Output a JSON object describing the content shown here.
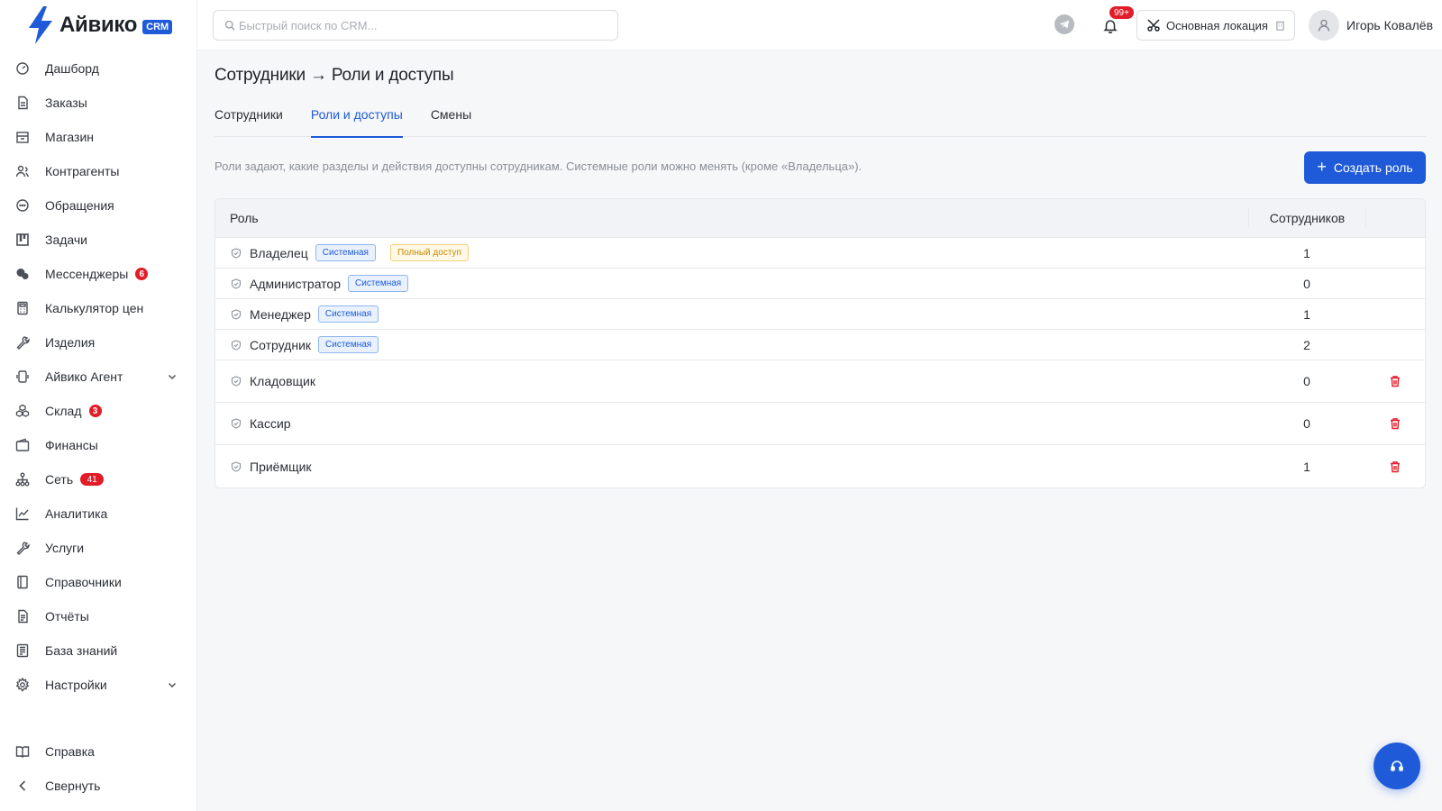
{
  "brand": {
    "name": "Айвико",
    "badge": "CRM",
    "accent": "#1f5bd8"
  },
  "sidebar": {
    "items": [
      {
        "label": "Дашборд",
        "icon": "dashboard-icon"
      },
      {
        "label": "Заказы",
        "icon": "document-icon"
      },
      {
        "label": "Магазин",
        "icon": "store-icon"
      },
      {
        "label": "Контрагенты",
        "icon": "contacts-icon"
      },
      {
        "label": "Обращения",
        "icon": "chat-icon"
      },
      {
        "label": "Задачи",
        "icon": "kanban-icon"
      },
      {
        "label": "Мессенджеры",
        "icon": "messengers-icon",
        "badge": "6"
      },
      {
        "label": "Калькулятор цен",
        "icon": "calculator-icon"
      },
      {
        "label": "Изделия",
        "icon": "wrench-icon"
      },
      {
        "label": "Айвико Агент",
        "icon": "agent-icon",
        "expandable": true
      },
      {
        "label": "Склад",
        "icon": "warehouse-icon",
        "badge": "3"
      },
      {
        "label": "Финансы",
        "icon": "wallet-icon"
      },
      {
        "label": "Сеть",
        "icon": "network-icon",
        "badge": "41"
      },
      {
        "label": "Аналитика",
        "icon": "chart-icon"
      },
      {
        "label": "Услуги",
        "icon": "tool-icon"
      },
      {
        "label": "Справочники",
        "icon": "book-icon"
      },
      {
        "label": "Отчёты",
        "icon": "report-icon"
      },
      {
        "label": "База знаний",
        "icon": "knowledge-icon"
      },
      {
        "label": "Настройки",
        "icon": "gear-icon",
        "expandable": true
      }
    ],
    "bottom": [
      {
        "label": "Справка",
        "icon": "help-book-icon"
      },
      {
        "label": "Свернуть",
        "icon": "chevron-left-icon"
      }
    ]
  },
  "topbar": {
    "search_placeholder": "Быстрый поиск по CRM...",
    "notifications_badge": "99+",
    "location": "Основная локация",
    "user_name": "Игорь Ковалёв"
  },
  "page": {
    "title": "Сотрудники → Роли и доступы",
    "tabs": [
      {
        "label": "Сотрудники",
        "active": false
      },
      {
        "label": "Роли и доступы",
        "active": true
      },
      {
        "label": "Смены",
        "active": false
      }
    ],
    "hint": "Роли задают, какие разделы и действия доступны сотрудникам. Системные роли можно менять (кроме «Владельца»).",
    "create_button": "Создать роль"
  },
  "table": {
    "columns": {
      "role": "Роль",
      "count": "Сотрудников"
    },
    "tag_system": "Системная",
    "tag_full": "Полный доступ",
    "rows": [
      {
        "name": "Владелец",
        "system": true,
        "full_access": true,
        "count": "1",
        "deletable": false
      },
      {
        "name": "Администратор",
        "system": true,
        "full_access": false,
        "count": "0",
        "deletable": false
      },
      {
        "name": "Менеджер",
        "system": true,
        "full_access": false,
        "count": "1",
        "deletable": false
      },
      {
        "name": "Сотрудник",
        "system": true,
        "full_access": false,
        "count": "2",
        "deletable": false
      },
      {
        "name": "Кладовщик",
        "system": false,
        "full_access": false,
        "count": "0",
        "deletable": true
      },
      {
        "name": "Кассир",
        "system": false,
        "full_access": false,
        "count": "0",
        "deletable": true
      },
      {
        "name": "Приёмщик",
        "system": false,
        "full_access": false,
        "count": "1",
        "deletable": true
      }
    ]
  }
}
